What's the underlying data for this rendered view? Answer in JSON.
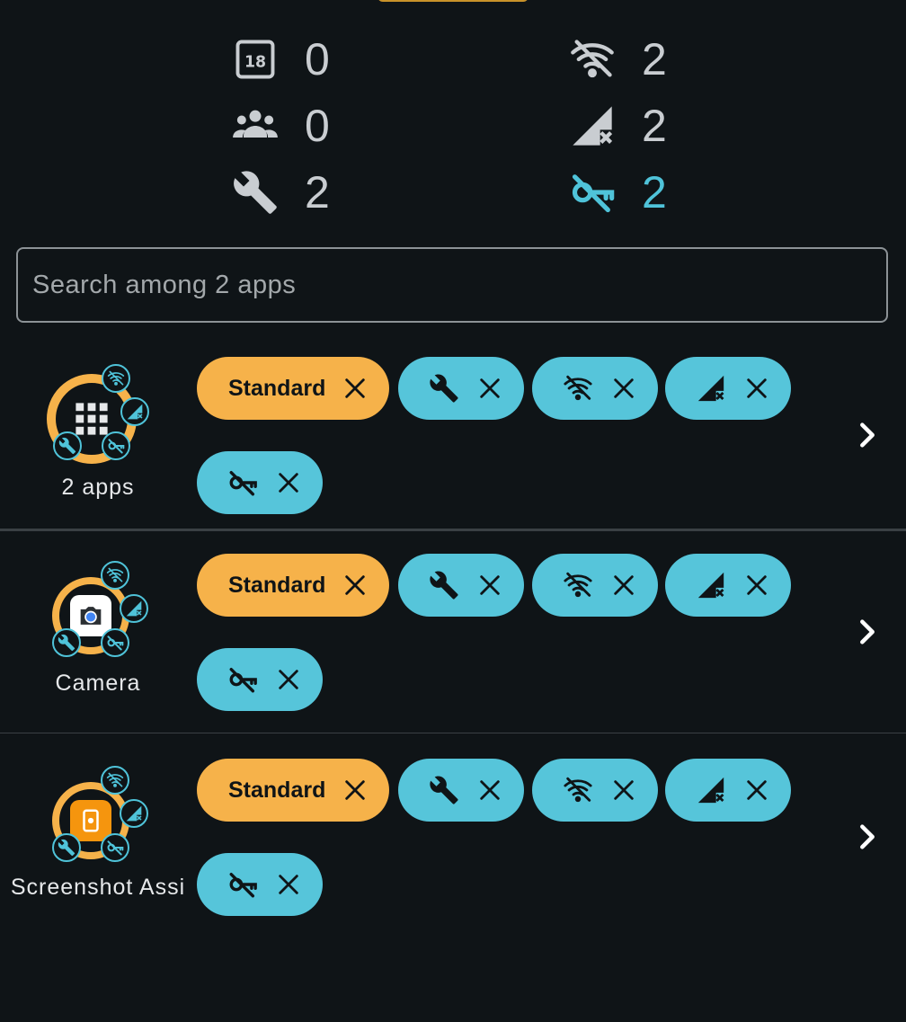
{
  "stats": {
    "left": [
      {
        "icon": "calendar-18-icon",
        "value": "0"
      },
      {
        "icon": "group-icon",
        "value": "0"
      },
      {
        "icon": "wrench-icon",
        "value": "2"
      }
    ],
    "right": [
      {
        "icon": "wifi-off-icon",
        "value": "2"
      },
      {
        "icon": "signal-off-icon",
        "value": "2"
      },
      {
        "icon": "vpn-key-off-icon",
        "value": "2",
        "active": true
      }
    ]
  },
  "search": {
    "placeholder": "Search among 2 apps",
    "value": ""
  },
  "rows": [
    {
      "label": "2 apps",
      "icon": "apps-grid-icon",
      "chips": {
        "standard": "Standard"
      }
    },
    {
      "label": "Camera",
      "icon": "camera-app-icon",
      "chips": {
        "standard": "Standard"
      }
    },
    {
      "label": "Screenshot Assi",
      "icon": "screenshot-assistant-app-icon",
      "chips": {
        "standard": "Standard"
      }
    }
  ],
  "colors": {
    "background": "#0f1417",
    "accent_orange": "#f6b24a",
    "accent_cyan": "#56c5da",
    "text_muted": "#c9cdd1"
  }
}
